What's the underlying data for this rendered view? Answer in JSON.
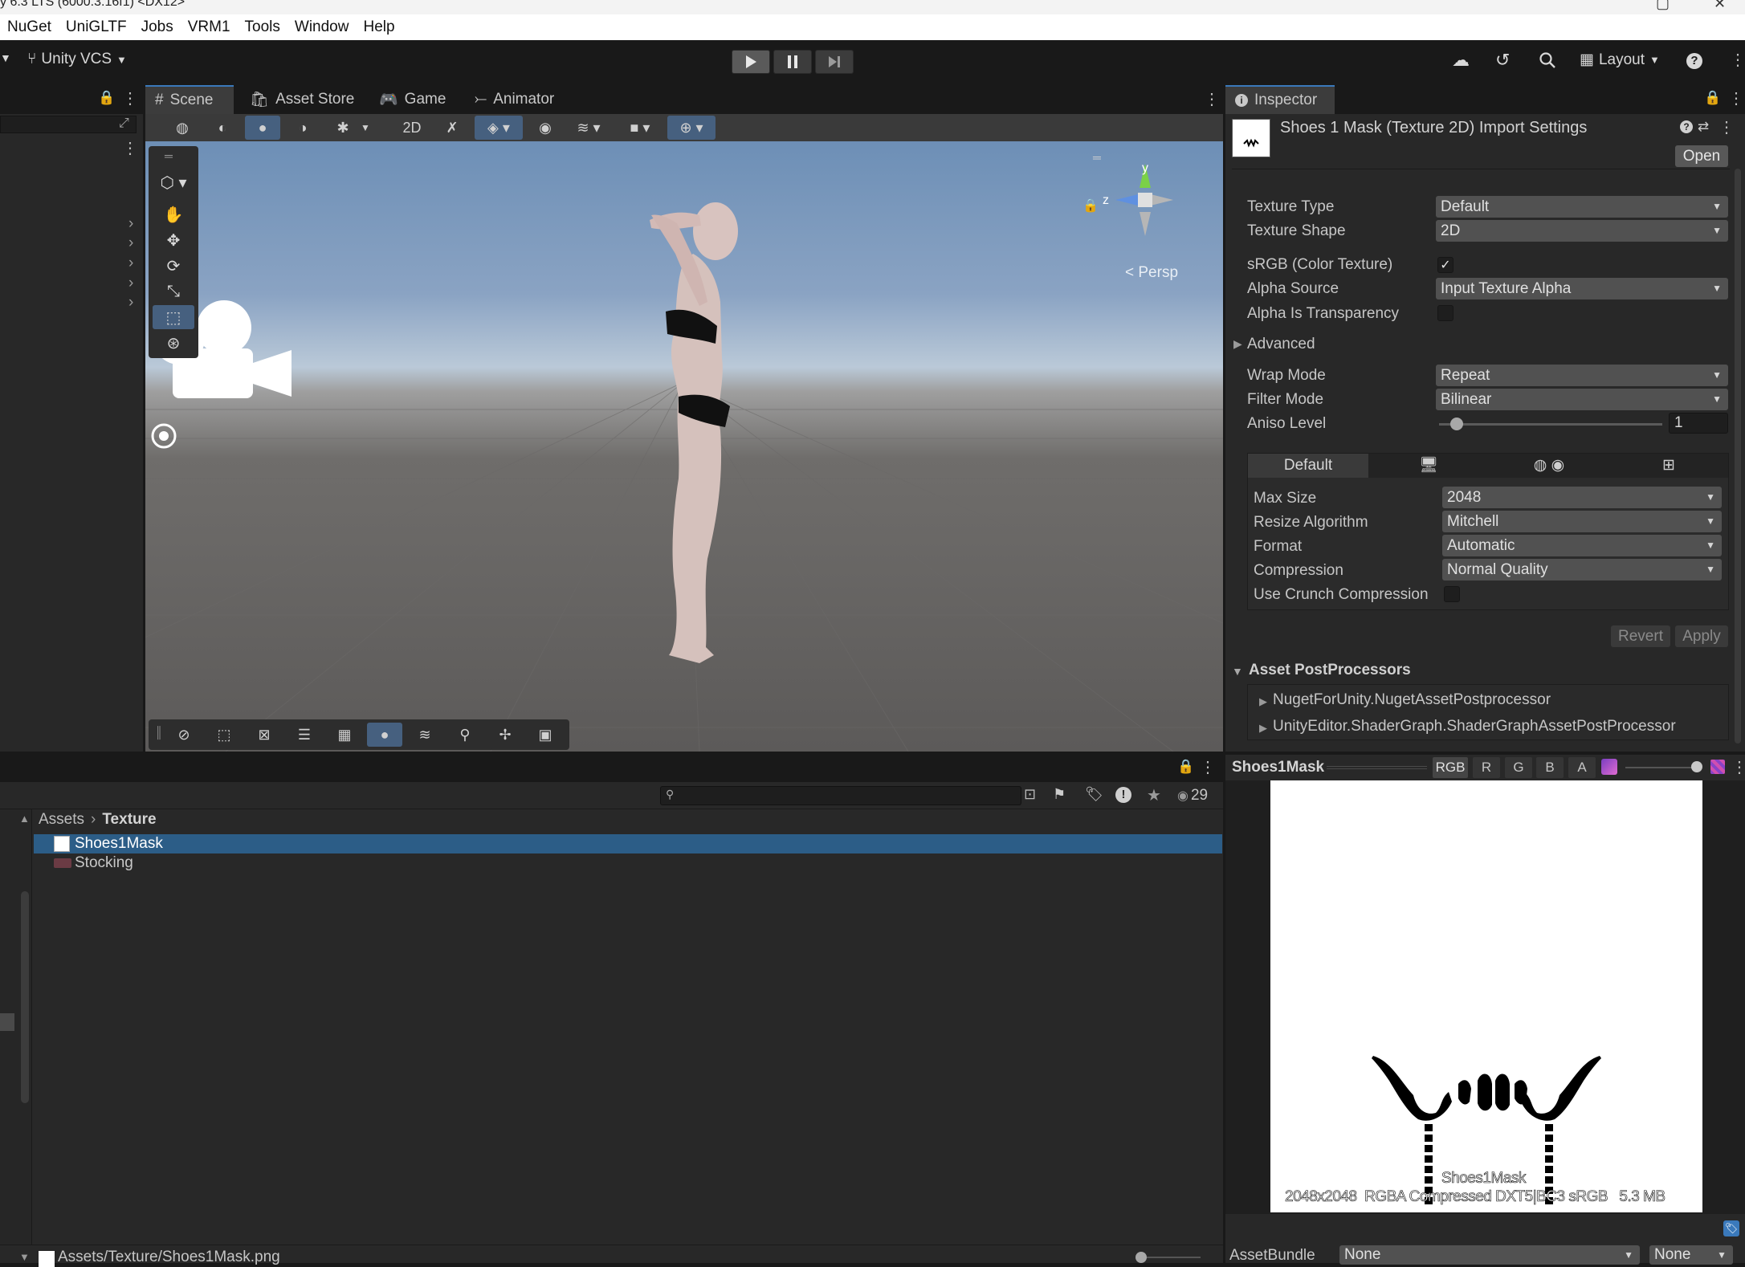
{
  "title_bar": {
    "text": "y 6.3 LTS (6000.3.16f1) <DX12>"
  },
  "menu": [
    "NuGet",
    "UniGLTF",
    "Jobs",
    "VRM1",
    "Tools",
    "Window",
    "Help"
  ],
  "toolbar": {
    "vcs_label": "Unity VCS",
    "layout_label": "Layout"
  },
  "scene_tabs": [
    "Scene",
    "Asset Store",
    "Game",
    "Animator"
  ],
  "scene": {
    "persp_label": "< Persp",
    "gizmo_y": "y",
    "gizmo_z": "z"
  },
  "inspector": {
    "tab": "Inspector",
    "header_title": "Shoes 1 Mask (Texture 2D) Import Settings",
    "open_button": "Open",
    "fields": {
      "texture_type": {
        "label": "Texture Type",
        "value": "Default"
      },
      "texture_shape": {
        "label": "Texture Shape",
        "value": "2D"
      },
      "srgb": {
        "label": "sRGB (Color Texture)",
        "checked": true,
        "mark": "✓"
      },
      "alpha_source": {
        "label": "Alpha Source",
        "value": "Input Texture Alpha"
      },
      "alpha_transparency": {
        "label": "Alpha Is Transparency",
        "checked": false
      },
      "advanced": {
        "label": "Advanced"
      },
      "wrap_mode": {
        "label": "Wrap Mode",
        "value": "Repeat"
      },
      "filter_mode": {
        "label": "Filter Mode",
        "value": "Bilinear"
      },
      "aniso_level": {
        "label": "Aniso Level",
        "value": "1",
        "slider_fraction": 0.08
      }
    },
    "platform_tabs": {
      "default_label": "Default"
    },
    "platform": {
      "max_size": {
        "label": "Max Size",
        "value": "2048"
      },
      "resize_algorithm": {
        "label": "Resize Algorithm",
        "value": "Mitchell"
      },
      "format": {
        "label": "Format",
        "value": "Automatic"
      },
      "compression": {
        "label": "Compression",
        "value": "Normal Quality"
      },
      "crunch": {
        "label": "Use Crunch Compression",
        "checked": false
      }
    },
    "revert_button": "Revert",
    "apply_button": "Apply",
    "postprocessors": {
      "title": "Asset PostProcessors",
      "items": [
        "NugetForUnity.NugetAssetPostprocessor",
        "UnityEditor.ShaderGraph.ShaderGraphAssetPostProcessor"
      ]
    }
  },
  "preview": {
    "title": "Shoes1Mask",
    "channels": [
      "RGB",
      "R",
      "G",
      "B",
      "A"
    ],
    "caption_name": "Shoes1Mask",
    "caption_info": "2048x2048  RGBA Compressed DXT5|BC3 sRGB   5.3 MB"
  },
  "asset_bundle": {
    "label": "AssetBundle",
    "value1": "None",
    "value2": "None"
  },
  "project": {
    "count": "29",
    "breadcrumb": {
      "root": "Assets",
      "current": "Texture"
    },
    "items": [
      {
        "name": "Shoes1Mask",
        "selected": true
      },
      {
        "name": "Stocking",
        "selected": false
      }
    ],
    "status_path": "Assets/Texture/Shoes1Mask.png"
  },
  "colors": {
    "accent": "#3a79bb",
    "selection": "#2c5d87",
    "panel": "#282828",
    "background": "#191919"
  }
}
